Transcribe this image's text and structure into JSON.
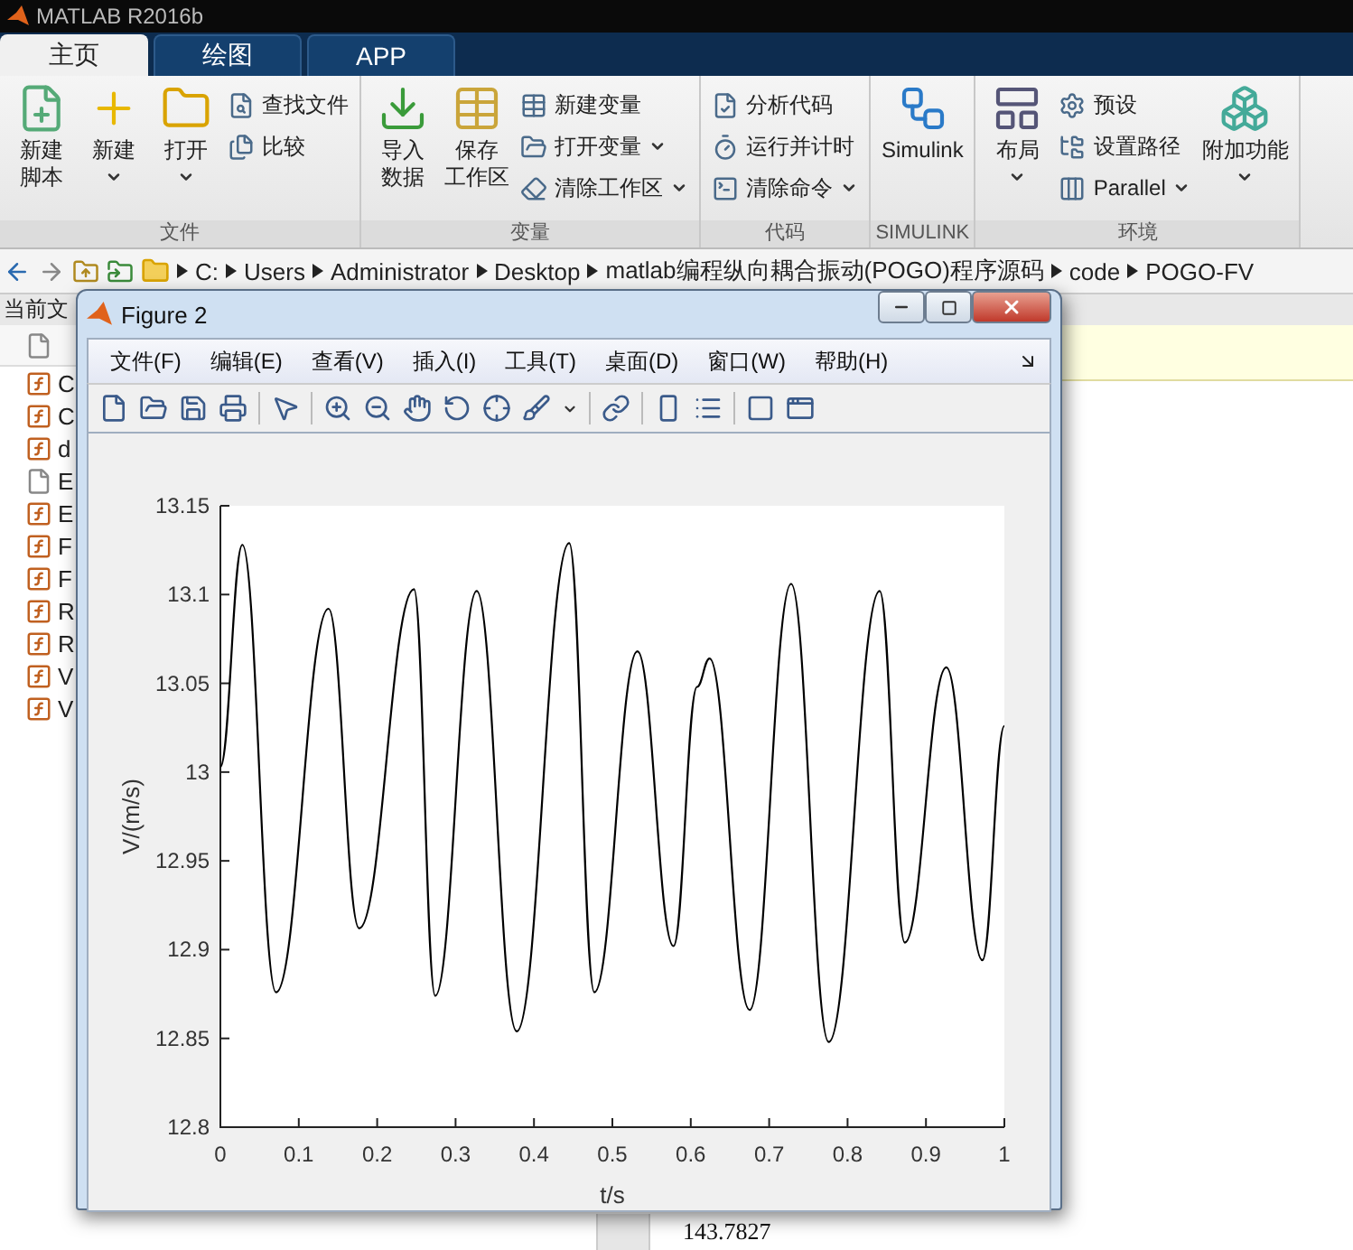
{
  "app_title": "MATLAB R2016b",
  "tabs": [
    {
      "label": "主页",
      "selected": true
    },
    {
      "label": "绘图",
      "selected": false
    },
    {
      "label": "APP",
      "selected": false
    }
  ],
  "ribbon": {
    "groups": [
      {
        "title": "文件",
        "items": [
          {
            "kind": "large",
            "label": [
              "新建",
              "脚本"
            ],
            "dropdown": false
          },
          {
            "kind": "large",
            "label": [
              "新建"
            ],
            "dropdown": true
          },
          {
            "kind": "large",
            "label": [
              "打开"
            ],
            "dropdown": true
          },
          {
            "kind": "stack",
            "buttons": [
              {
                "label": "查找文件",
                "dropdown": false
              },
              {
                "label": "比较",
                "dropdown": false
              }
            ]
          }
        ]
      },
      {
        "title": "变量",
        "items": [
          {
            "kind": "large",
            "label": [
              "导入",
              "数据"
            ],
            "dropdown": false
          },
          {
            "kind": "large",
            "label": [
              "保存",
              "工作区"
            ],
            "dropdown": false
          },
          {
            "kind": "stack",
            "buttons": [
              {
                "label": "新建变量",
                "dropdown": false
              },
              {
                "label": "打开变量",
                "dropdown": true
              },
              {
                "label": "清除工作区",
                "dropdown": true
              }
            ]
          }
        ]
      },
      {
        "title": "代码",
        "items": [
          {
            "kind": "stack",
            "buttons": [
              {
                "label": "分析代码",
                "dropdown": false
              },
              {
                "label": "运行并计时",
                "dropdown": false
              },
              {
                "label": "清除命令",
                "dropdown": true
              }
            ]
          }
        ]
      },
      {
        "title": "SIMULINK",
        "items": [
          {
            "kind": "large",
            "label": [
              "Simulink"
            ],
            "dropdown": false
          }
        ]
      },
      {
        "title": "环境",
        "items": [
          {
            "kind": "large",
            "label": [
              "布局"
            ],
            "dropdown": true
          },
          {
            "kind": "stack",
            "buttons": [
              {
                "label": "预设",
                "dropdown": false
              },
              {
                "label": "设置路径",
                "dropdown": false
              },
              {
                "label": "Parallel",
                "dropdown": true
              }
            ]
          },
          {
            "kind": "large",
            "label": [
              "附加功能"
            ],
            "dropdown": true
          }
        ]
      }
    ]
  },
  "address_bar": {
    "path": [
      "C:",
      "Users",
      "Administrator",
      "Desktop",
      "matlab编程纵向耦合振动(POGO)程序源码",
      "code",
      "POGO-FV"
    ]
  },
  "current_folder": {
    "title": "当前文",
    "files": [
      {
        "name": "C",
        "kind": "function"
      },
      {
        "name": "C",
        "kind": "function"
      },
      {
        "name": "d",
        "kind": "function"
      },
      {
        "name": "E",
        "kind": "plain"
      },
      {
        "name": "E",
        "kind": "function"
      },
      {
        "name": "F",
        "kind": "function"
      },
      {
        "name": "F",
        "kind": "function"
      },
      {
        "name": "R",
        "kind": "function"
      },
      {
        "name": "R",
        "kind": "function"
      },
      {
        "name": "V",
        "kind": "function"
      },
      {
        "name": "V",
        "kind": "function"
      }
    ]
  },
  "command_window": {
    "output": "143.7827"
  },
  "figure": {
    "title": "Figure 2",
    "menu": [
      "文件(F)",
      "编辑(E)",
      "查看(V)",
      "插入(I)",
      "工具(T)",
      "桌面(D)",
      "窗口(W)",
      "帮助(H)"
    ],
    "chart_data": {
      "type": "line",
      "xlabel": "t/s",
      "ylabel": "V/(m/s)",
      "x": [
        0,
        0.028,
        0.071,
        0.138,
        0.177,
        0.247,
        0.274,
        0.327,
        0.378,
        0.445,
        0.477,
        0.532,
        0.578,
        0.608,
        0.624,
        0.675,
        0.728,
        0.776,
        0.841,
        0.873,
        0.926,
        0.972,
        1
      ],
      "series": [
        {
          "color": "#000000",
          "values": [
            13.003,
            13.128,
            12.876,
            13.092,
            12.912,
            13.103,
            12.874,
            13.102,
            12.854,
            13.129,
            12.876,
            13.068,
            12.902,
            13.048,
            13.064,
            12.866,
            13.106,
            12.848,
            13.102,
            12.904,
            13.059,
            12.894,
            13.026
          ]
        }
      ],
      "xlim": [
        0,
        1
      ],
      "ylim": [
        12.8,
        13.15
      ],
      "xticks": [
        0,
        0.1,
        0.2,
        0.3,
        0.4,
        0.5,
        0.6,
        0.7,
        0.8,
        0.9,
        1
      ],
      "yticks": [
        12.8,
        12.85,
        12.9,
        12.95,
        13,
        13.05,
        13.1,
        13.15
      ]
    }
  }
}
